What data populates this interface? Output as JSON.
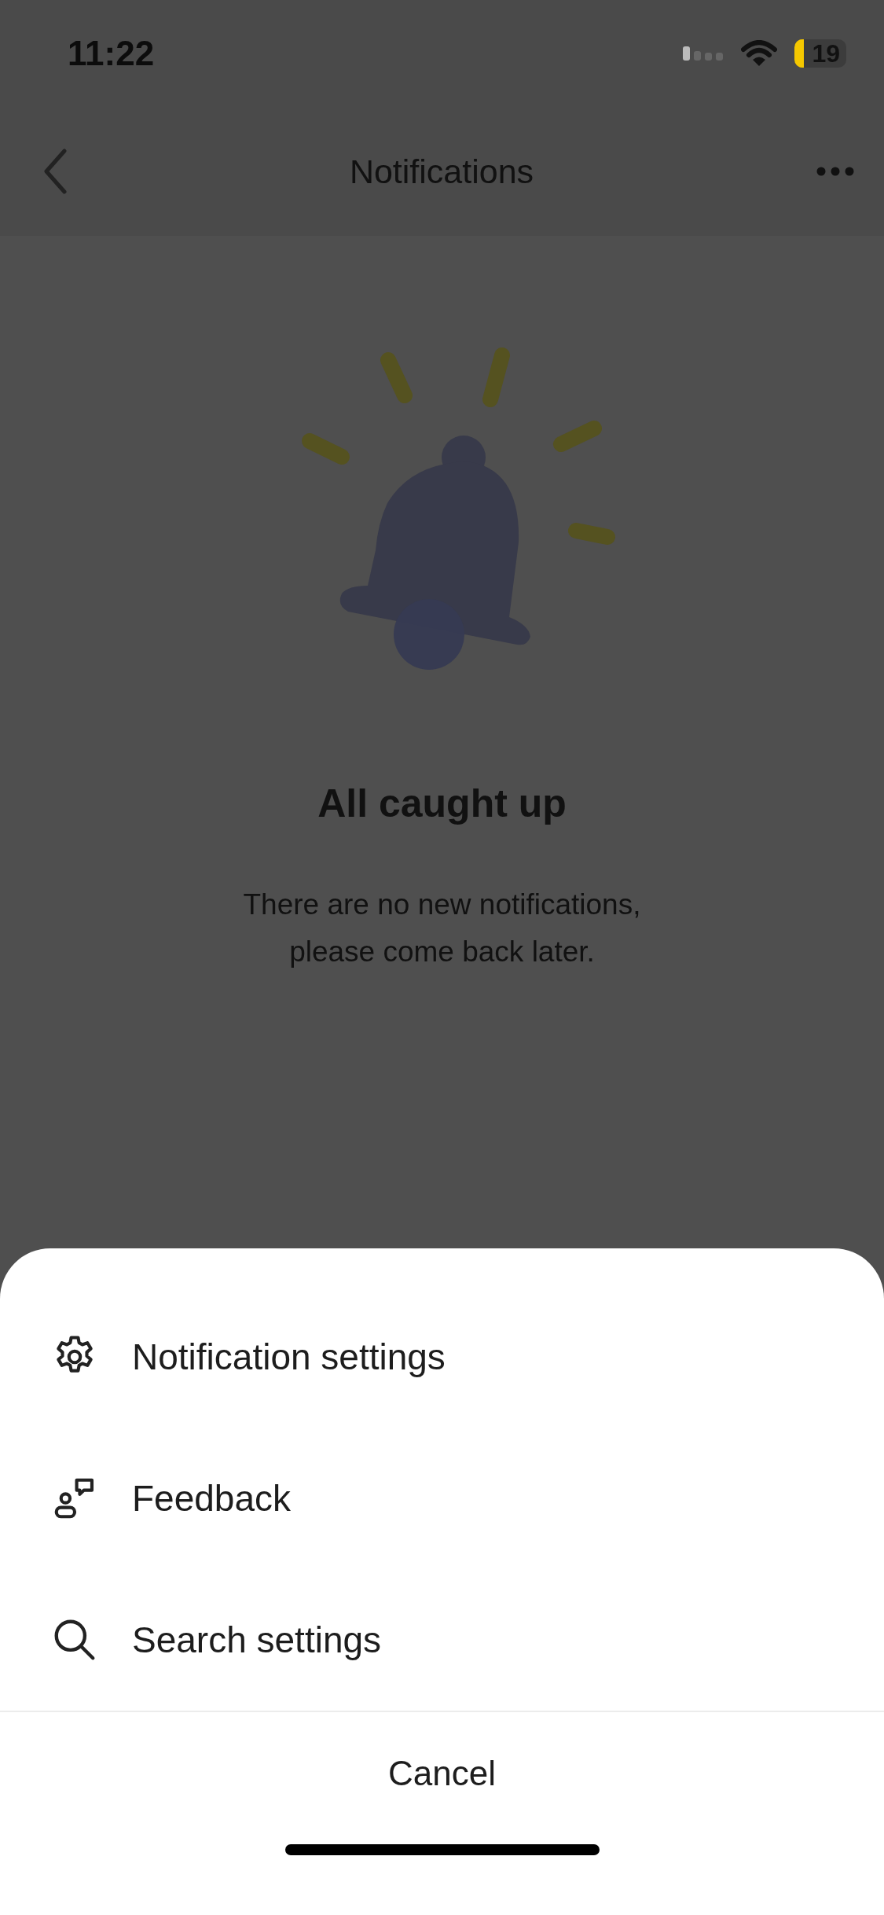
{
  "status_bar": {
    "time": "11:22",
    "battery": "19"
  },
  "nav_bar": {
    "title": "Notifications"
  },
  "empty_state": {
    "title": "All caught up",
    "message": "There are no new notifications, please come back later."
  },
  "action_sheet": {
    "items": [
      {
        "kind": "settings",
        "label": "Notification settings"
      },
      {
        "kind": "feedback",
        "label": "Feedback"
      },
      {
        "kind": "search",
        "label": "Search settings"
      }
    ],
    "cancel": "Cancel"
  }
}
